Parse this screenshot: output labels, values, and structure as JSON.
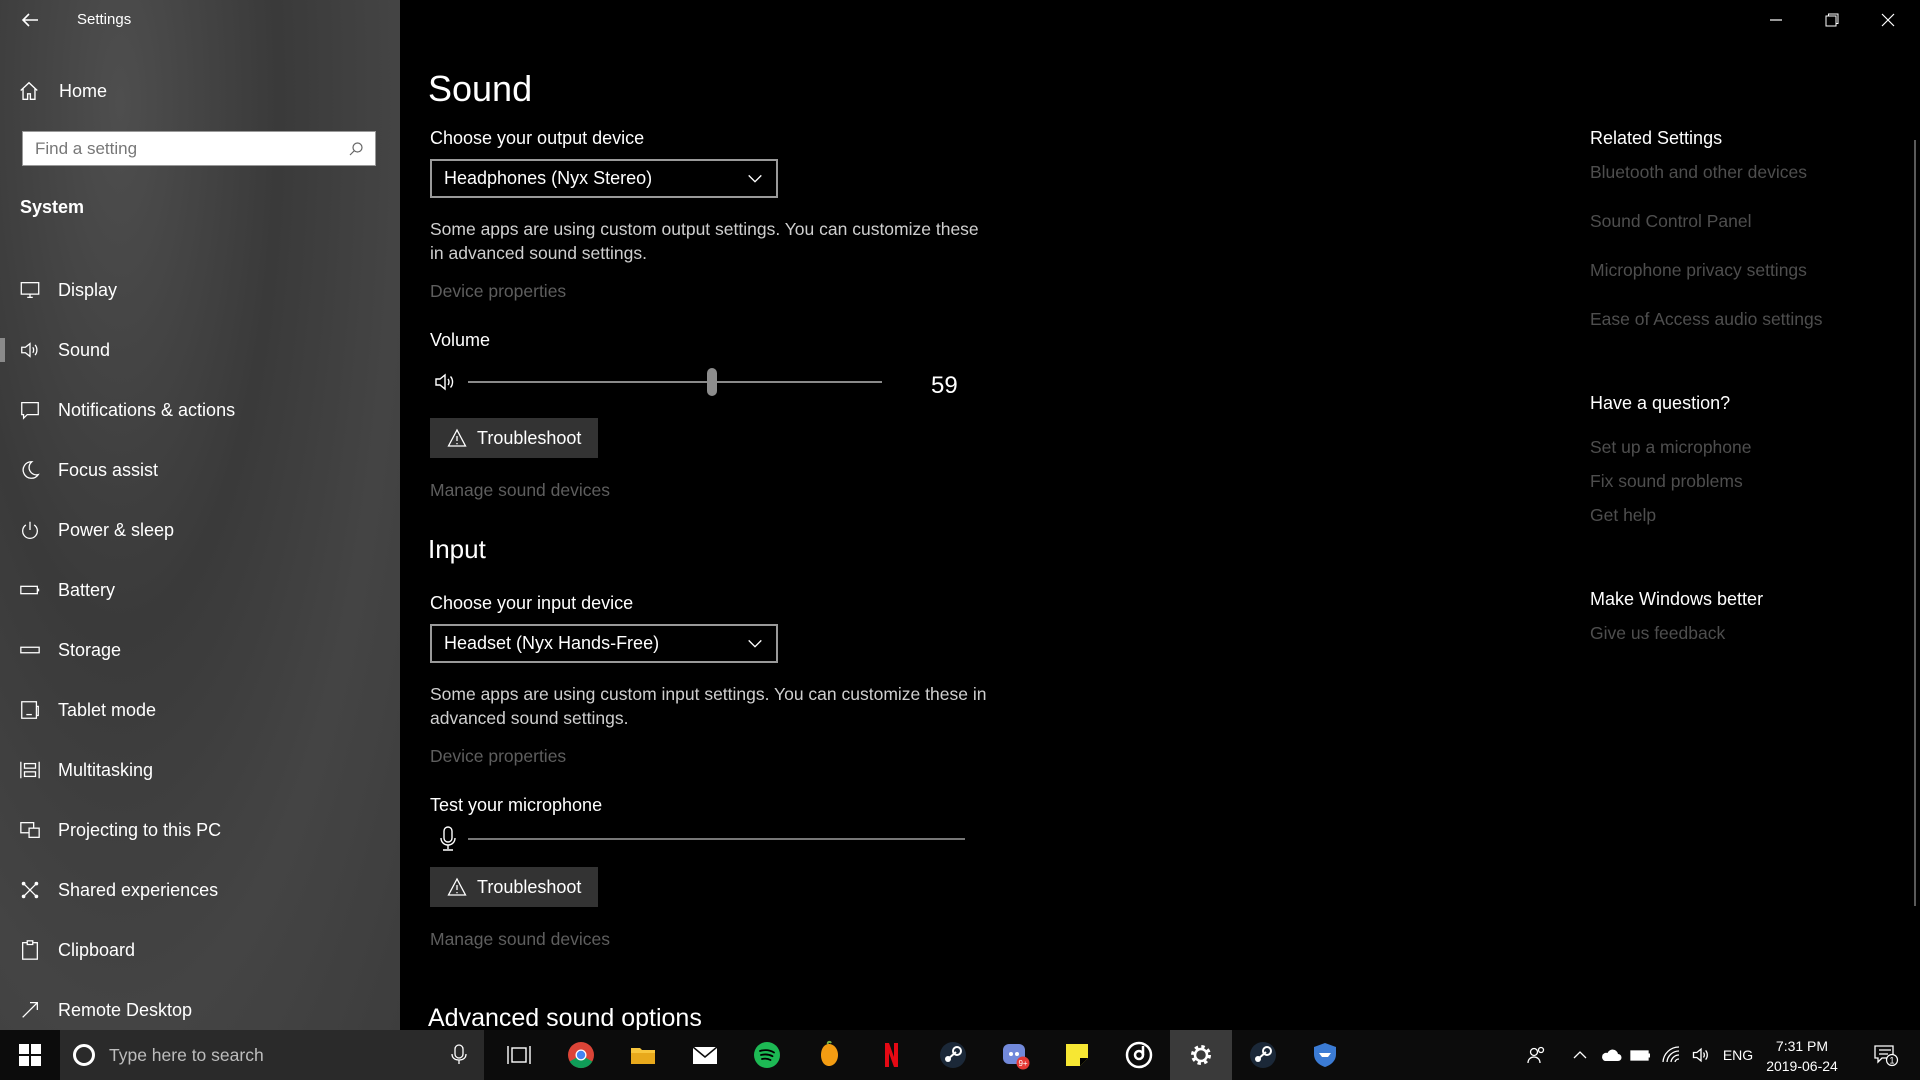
{
  "window": {
    "title": "Settings"
  },
  "sidebar": {
    "home_label": "Home",
    "search_placeholder": "Find a setting",
    "section_title": "System",
    "items": [
      {
        "label": "Display",
        "icon": "display-icon"
      },
      {
        "label": "Sound",
        "icon": "speaker-icon",
        "selected": true
      },
      {
        "label": "Notifications & actions",
        "icon": "notification-icon"
      },
      {
        "label": "Focus assist",
        "icon": "moon-icon"
      },
      {
        "label": "Power & sleep",
        "icon": "power-icon"
      },
      {
        "label": "Battery",
        "icon": "battery-icon"
      },
      {
        "label": "Storage",
        "icon": "storage-icon"
      },
      {
        "label": "Tablet mode",
        "icon": "tablet-icon"
      },
      {
        "label": "Multitasking",
        "icon": "multitasking-icon"
      },
      {
        "label": "Projecting to this PC",
        "icon": "projecting-icon"
      },
      {
        "label": "Shared experiences",
        "icon": "shared-icon"
      },
      {
        "label": "Clipboard",
        "icon": "clipboard-icon"
      },
      {
        "label": "Remote Desktop",
        "icon": "remote-desktop-icon"
      }
    ]
  },
  "main": {
    "title": "Sound",
    "output": {
      "label": "Choose your output device",
      "device": "Headphones (Nyx Stereo)",
      "description": "Some apps are using custom output settings. You can customize these in advanced sound settings.",
      "device_properties": "Device properties",
      "volume_label": "Volume",
      "volume_value": "59",
      "volume_fraction": 0.59,
      "troubleshoot": "Troubleshoot",
      "manage": "Manage sound devices"
    },
    "input": {
      "heading": "Input",
      "label": "Choose your input device",
      "device": "Headset (Nyx Hands-Free)",
      "description": "Some apps are using custom input settings. You can customize these in advanced sound settings.",
      "device_properties": "Device properties",
      "test_label": "Test your microphone",
      "troubleshoot": "Troubleshoot",
      "manage": "Manage sound devices"
    },
    "advanced_heading": "Advanced sound options"
  },
  "related": {
    "title": "Related Settings",
    "links": [
      "Bluetooth and other devices",
      "Sound Control Panel",
      "Microphone privacy settings",
      "Ease of Access audio settings"
    ],
    "question_title": "Have a question?",
    "question_links": [
      "Set up a microphone",
      "Fix sound problems",
      "Get help"
    ],
    "better_title": "Make Windows better",
    "better_links": [
      "Give us feedback"
    ]
  },
  "taskbar": {
    "search_placeholder": "Type here to search",
    "apps": [
      "task-view",
      "chrome",
      "file-explorer",
      "mail",
      "spotify",
      "fl-studio",
      "netflix",
      "steam",
      "discord",
      "sticky-notes",
      "groove-music",
      "settings",
      "steam-2",
      "bitwarden"
    ],
    "language": "ENG",
    "time": "7:31 PM",
    "date": "2019-06-24",
    "notification_count": "1",
    "discord_badge": "9+"
  },
  "colors": {
    "sidebar_bg": "#404040",
    "main_bg": "#000000",
    "dim_link": "#5e5e5e",
    "button_bg": "#333333"
  }
}
